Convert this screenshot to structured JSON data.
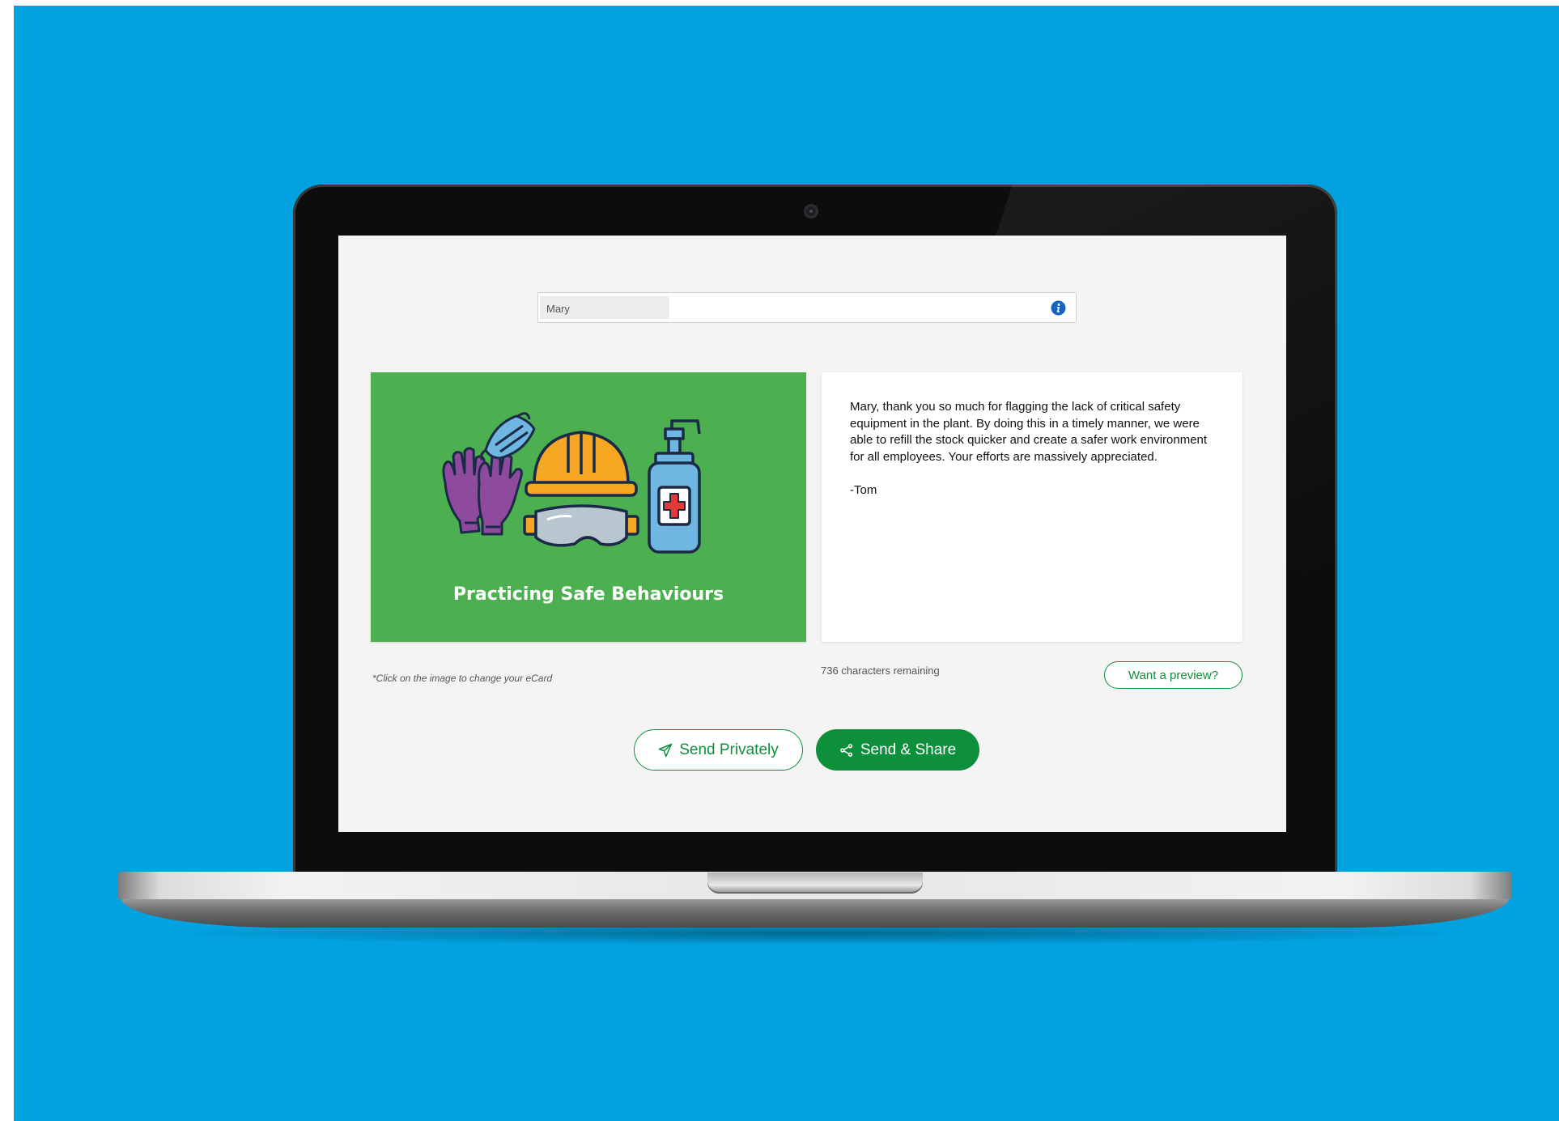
{
  "recipient": {
    "value": "Mary"
  },
  "ecard": {
    "title": "Practicing Safe Behaviours",
    "hint": "*Click on the image to change your eCard"
  },
  "message": {
    "text": "Mary, thank you so much for flagging the lack of critical safety equipment in the plant. By doing this in a timely manner, we were able to refill the stock quicker and create a safer work environment for all employees. Your efforts are massively appreciated.\n\n-Tom",
    "chars_remaining": "736 characters remaining"
  },
  "actions": {
    "preview_label": "Want a preview?",
    "send_privately_label": "Send Privately",
    "send_share_label": "Send & Share"
  },
  "icons": [
    "info-icon",
    "paper-plane-icon",
    "share-icon",
    "gloves-icon",
    "face-mask-icon",
    "hard-hat-icon",
    "safety-goggles-icon",
    "hand-sanitizer-icon"
  ],
  "colors": {
    "background": "#02a2e0",
    "card_green": "#4caf50",
    "accent_green": "#0e8f3c",
    "info_blue": "#1565c0"
  }
}
